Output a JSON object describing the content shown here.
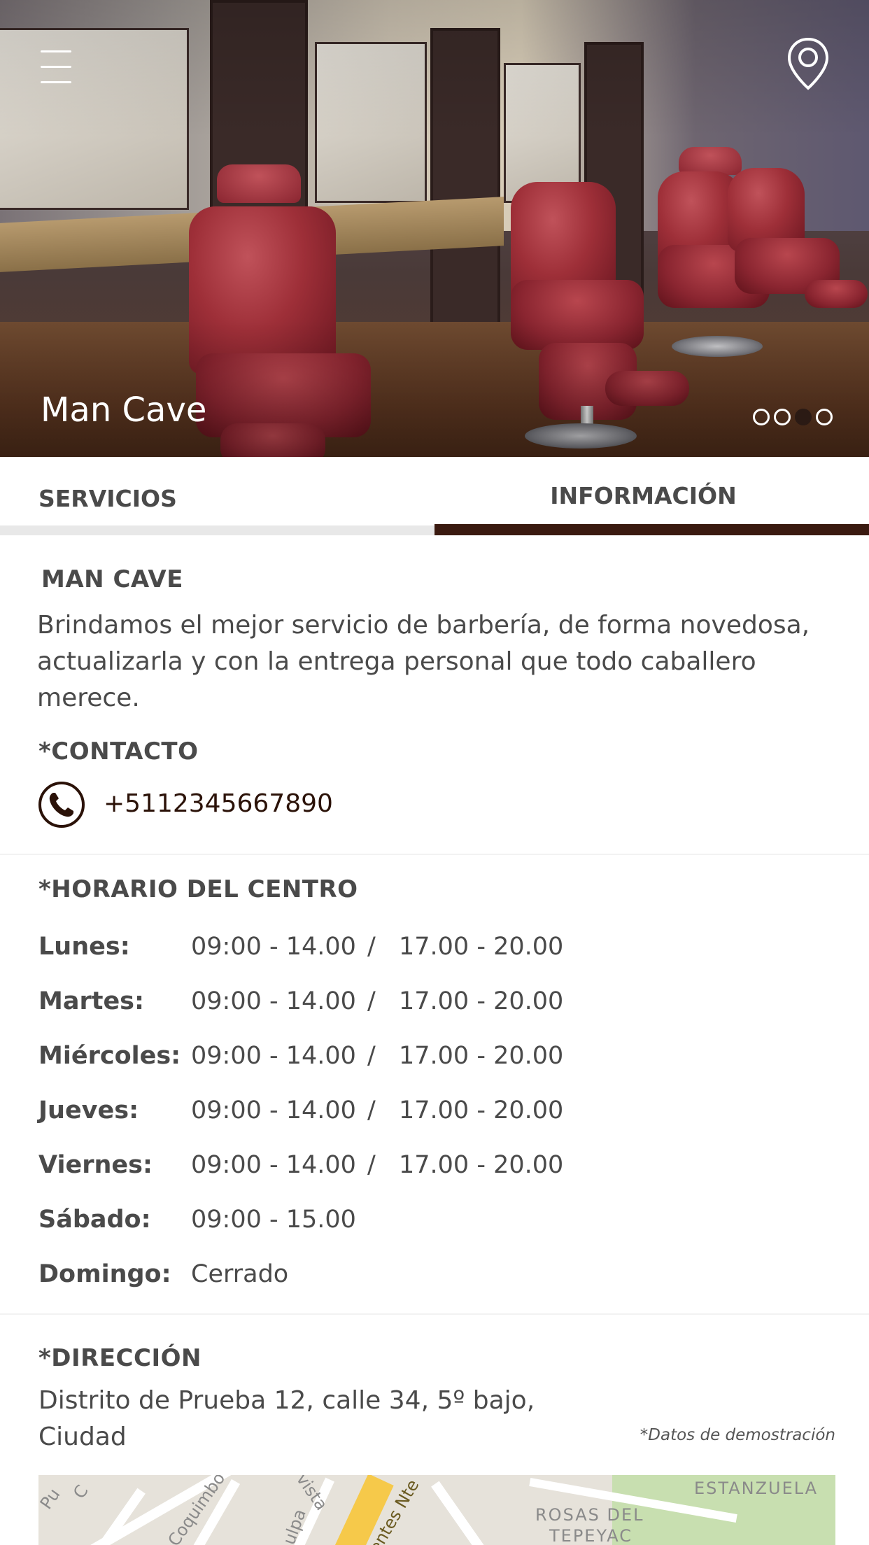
{
  "hero": {
    "title": "Man Cave",
    "menu_icon": "hamburger-menu-icon",
    "location_icon": "map-pin-icon",
    "carousel": {
      "count": 4,
      "active_index": 2
    }
  },
  "tabs": [
    {
      "label": "SERVICIOS",
      "active": false
    },
    {
      "label": "INFORMACIÓN",
      "active": true
    }
  ],
  "about": {
    "title": "MAN CAVE",
    "description_lines": [
      "Brindamos el mejor servicio de barbería, de forma novedosa,",
      "actualizarla y con la entrega personal que todo caballero",
      "merece."
    ]
  },
  "contact": {
    "title": "*CONTACTO",
    "phone_icon": "phone-icon",
    "phone": "+5112345667890"
  },
  "schedule": {
    "title": "*HORARIO DEL CENTRO",
    "rows": [
      {
        "day": "Lunes:",
        "morning": "09:00 - 14.00",
        "separator": "/",
        "afternoon": "17.00 - 20.00"
      },
      {
        "day": "Martes:",
        "morning": "09:00 - 14.00",
        "separator": "/",
        "afternoon": "17.00 - 20.00"
      },
      {
        "day": "Miércoles:",
        "morning": "09:00 - 14.00",
        "separator": "/",
        "afternoon": "17.00 - 20.00"
      },
      {
        "day": "Jueves:",
        "morning": "09:00 - 14.00",
        "separator": "/",
        "afternoon": "17.00 - 20.00"
      },
      {
        "day": "Viernes:",
        "morning": "09:00 - 14.00",
        "separator": "/",
        "afternoon": "17.00 - 20.00"
      },
      {
        "day": "Sábado:",
        "morning": "09:00 - 15.00",
        "separator": "",
        "afternoon": ""
      },
      {
        "day": "Domingo:",
        "morning": "Cerrado",
        "separator": "",
        "afternoon": ""
      }
    ]
  },
  "address": {
    "title": "*DIRECCIÓN",
    "lines": [
      "Distrito de Prueba 12, calle 34, 5º bajo,",
      "Ciudad"
    ],
    "demo_note": "*Datos de demostración"
  },
  "map": {
    "labels": [
      "Coquimbo",
      "ESTANZUELA",
      "ROSAS DEL",
      "TEPEYAC",
      "entes Nte",
      "Pu",
      "C",
      "vista",
      "ulpa"
    ]
  },
  "colors": {
    "accent": "#3a1a10",
    "text": "#4a4a4a",
    "tab_inactive_bar": "#e8e8e8",
    "phone_text": "#2b1208"
  }
}
